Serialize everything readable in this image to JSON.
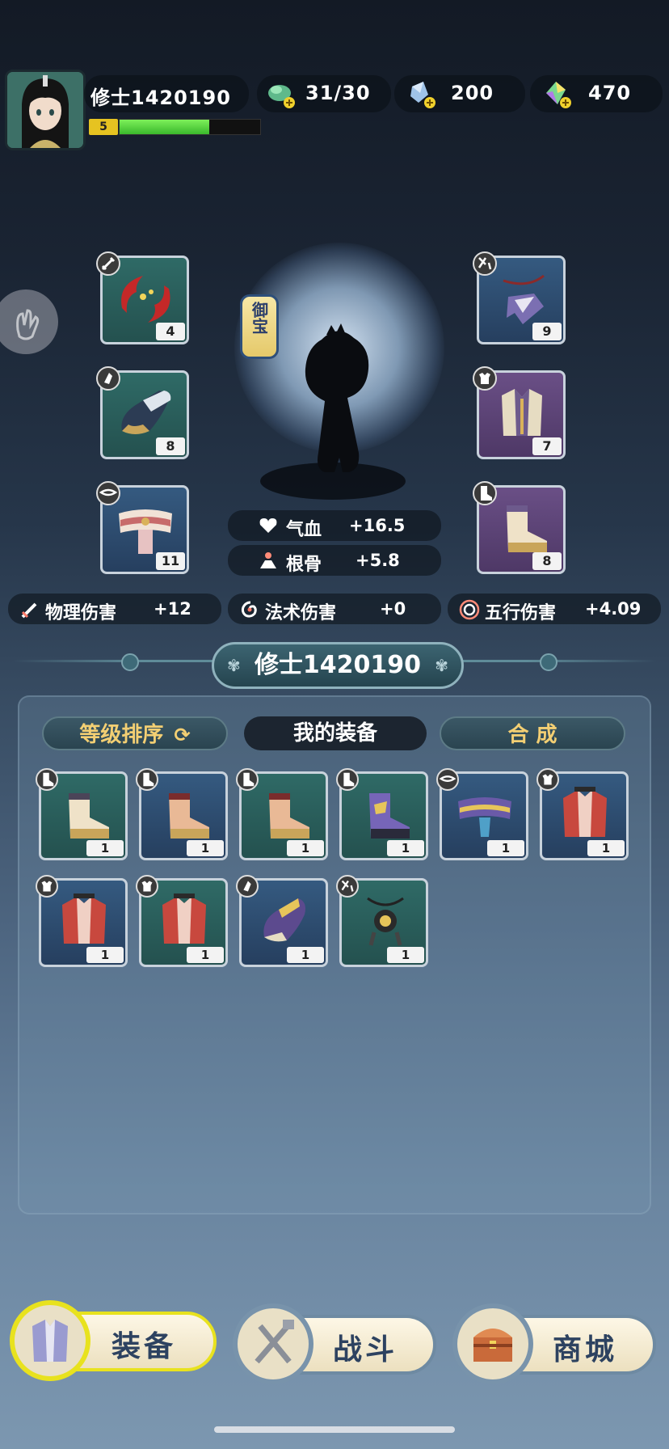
{
  "player": {
    "name": "修士1420190",
    "level": "5",
    "xp_fraction": 0.64
  },
  "resources": [
    {
      "icon": "stamina-icon",
      "value": "31/30"
    },
    {
      "icon": "crystal-icon",
      "value": "200"
    },
    {
      "icon": "gem-icon",
      "value": "470"
    }
  ],
  "treasure_label": "御宝",
  "equipped": {
    "left": [
      {
        "icon": "weapon-slot-badge-icon",
        "item": "red-ribbon-weapon",
        "count": "4"
      },
      {
        "icon": "helmet-slot-badge-icon",
        "item": "helmet",
        "count": "8"
      },
      {
        "icon": "belt-slot-badge-icon",
        "item": "belt",
        "count": "11"
      }
    ],
    "right": [
      {
        "icon": "amulet-slot-badge-icon",
        "item": "amulet",
        "count": "9"
      },
      {
        "icon": "armor-slot-badge-icon",
        "item": "robe",
        "count": "7"
      },
      {
        "icon": "boots-slot-badge-icon",
        "item": "boots",
        "count": "8"
      }
    ]
  },
  "char_stats": [
    {
      "icon": "heart-icon",
      "label": "气血",
      "value": "+16.5"
    },
    {
      "icon": "person-icon",
      "label": "根骨",
      "value": "+5.8"
    }
  ],
  "damage_stats": [
    {
      "icon": "sword-icon",
      "label": "物理伤害",
      "value": "+12"
    },
    {
      "icon": "swirl-icon",
      "label": "法术伤害",
      "value": "+0"
    },
    {
      "icon": "spiral-icon",
      "label": "五行伤害",
      "value": "+4.09"
    }
  ],
  "panel_title": "修士1420190",
  "tabs": {
    "sort": "等级排序",
    "mine": "我的装备",
    "craft": "合 成"
  },
  "inventory": [
    {
      "slot": "boots",
      "count": "1"
    },
    {
      "slot": "boots",
      "count": "1"
    },
    {
      "slot": "boots",
      "count": "1"
    },
    {
      "slot": "boots",
      "count": "1"
    },
    {
      "slot": "belt",
      "count": "1"
    },
    {
      "slot": "armor",
      "count": "1"
    },
    {
      "slot": "armor",
      "count": "1"
    },
    {
      "slot": "armor",
      "count": "1"
    },
    {
      "slot": "helmet",
      "count": "1"
    },
    {
      "slot": "amulet",
      "count": "1"
    }
  ],
  "nav": [
    {
      "label": "装备",
      "icon": "armor-nav-icon",
      "active": true
    },
    {
      "label": "战斗",
      "icon": "crossed-weapons-nav-icon",
      "active": false
    },
    {
      "label": "商城",
      "icon": "treasure-chest-nav-icon",
      "active": false
    }
  ],
  "colors": {
    "accent_gold": "#f3cf73",
    "xp_green": "#5fd842",
    "level_yellow": "#e6c321",
    "active_nav_ring": "#e8e21e"
  }
}
